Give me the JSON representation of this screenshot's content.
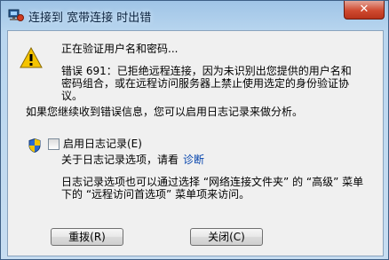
{
  "window": {
    "title": "连接到 宽带连接 时出错",
    "close_glyph": "✕"
  },
  "dialog": {
    "status": "正在验证用户名和密码...",
    "error_line1": "错误 691：已拒绝远程连接，因为未识别出您提供的用户名和",
    "error_line2": "密码组合，或在远程访问服务器上禁止使用选定的身份验证协",
    "error_line3": "议。",
    "advice": "如果您继续收到错误信息，您可以启用日志记录来做分析。",
    "logging_checkbox_label": "启用日志记录(E)",
    "logging_checked": false,
    "logging_info_prefix": "关于日志记录选项，请看",
    "diagnose_link": "诊断",
    "options_line1": "日志记录选项也可以通过选择 “网络连接文件夹” 的 “高级” 菜单",
    "options_line2": "下的 “远程访问首选项” 菜单项来访问。"
  },
  "buttons": {
    "redial": "重拨(R)",
    "close": "关闭(C)"
  },
  "colors": {
    "title_gradient_top": "#9fc4e6",
    "close_button": "#cf4a30",
    "link": "#0645ad",
    "warning": "#f5c400"
  },
  "icons": {
    "app": "network-connection-icon",
    "warning": "warning-icon",
    "shield": "uac-shield-icon"
  }
}
